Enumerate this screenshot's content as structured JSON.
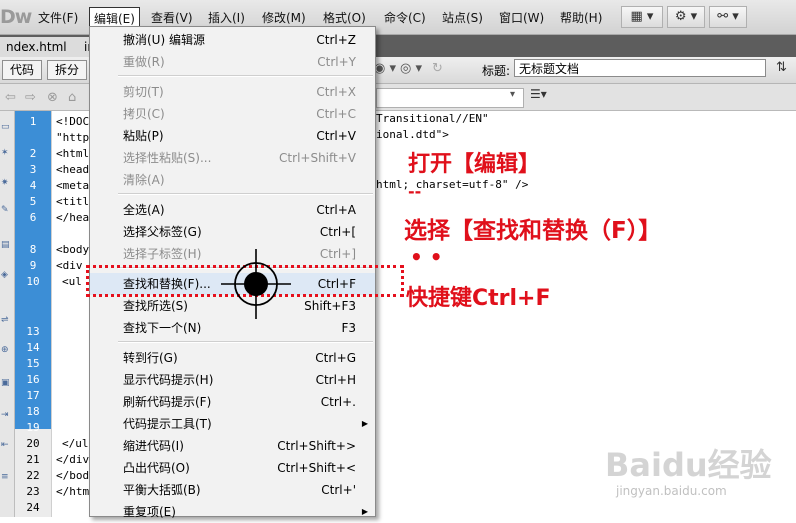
{
  "app": {
    "logo": "Dw"
  },
  "menubar": {
    "items": [
      "文件(F)",
      "编辑(E)",
      "查看(V)",
      "插入(I)",
      "修改(M)",
      "格式(O)",
      "命令(C)",
      "站点(S)",
      "窗口(W)",
      "帮助(H)"
    ],
    "active": "编辑(E)"
  },
  "tabs": [
    {
      "label": "ndex.html",
      "close": "×"
    },
    {
      "label": "ir",
      "close": ""
    }
  ],
  "doc_toolbar": {
    "view_buttons": [
      "代码",
      "拆分"
    ],
    "title_label": "标题:",
    "title_value": "无标题文档"
  },
  "gutter": {
    "line_numbers": [
      "1",
      "",
      "2",
      "3",
      "4",
      "5",
      "6",
      "",
      "8",
      "9",
      "10",
      "",
      "",
      "13",
      "14",
      "15",
      "16",
      "17",
      "18",
      "19",
      "20",
      "21",
      "22",
      "23",
      "24"
    ]
  },
  "code": {
    "left_fragments": [
      "<!DOC",
      "\"http",
      "<html",
      "<head",
      "<meta",
      "<titl",
      "</hea",
      "",
      "<body",
      "<div",
      "<ul",
      "",
      "",
      "",
      "",
      "",
      "",
      "",
      "",
      "",
      "</ul",
      "</div",
      "</bod",
      "</htm",
      ""
    ],
    "right_fragments": [
      "Transitional//EN\"",
      "ional.dtd\">",
      "",
      "",
      "html; charset=utf-8\" />"
    ]
  },
  "edit_menu": {
    "items": [
      {
        "label": "撤消(U) 编辑源",
        "shortcut": "Ctrl+Z",
        "disabled": false
      },
      {
        "label": "重做(R)",
        "shortcut": "Ctrl+Y",
        "disabled": true
      },
      {
        "label": "剪切(T)",
        "shortcut": "Ctrl+X",
        "disabled": true
      },
      {
        "label": "拷贝(C)",
        "shortcut": "Ctrl+C",
        "disabled": true
      },
      {
        "label": "粘贴(P)",
        "shortcut": "Ctrl+V",
        "disabled": false
      },
      {
        "label": "选择性粘贴(S)...",
        "shortcut": "Ctrl+Shift+V",
        "disabled": true
      },
      {
        "label": "清除(A)",
        "shortcut": "",
        "disabled": true
      },
      {
        "label": "全选(A)",
        "shortcut": "Ctrl+A",
        "disabled": false
      },
      {
        "label": "选择父标签(G)",
        "shortcut": "Ctrl+[",
        "disabled": false
      },
      {
        "label": "选择子标签(H)",
        "shortcut": "Ctrl+]",
        "disabled": true
      },
      {
        "label": "查找和替换(F)...",
        "shortcut": "Ctrl+F",
        "disabled": false
      },
      {
        "label": "查找所选(S)",
        "shortcut": "Shift+F3",
        "disabled": false
      },
      {
        "label": "查找下一个(N)",
        "shortcut": "F3",
        "disabled": false
      },
      {
        "label": "转到行(G)",
        "shortcut": "Ctrl+G",
        "disabled": false
      },
      {
        "label": "显示代码提示(H)",
        "shortcut": "Ctrl+H",
        "disabled": false
      },
      {
        "label": "刷新代码提示(F)",
        "shortcut": "Ctrl+.",
        "disabled": false
      },
      {
        "label": "代码提示工具(T)",
        "shortcut": "",
        "disabled": false,
        "submenu": true
      },
      {
        "label": "缩进代码(I)",
        "shortcut": "Ctrl+Shift+>",
        "disabled": false
      },
      {
        "label": "凸出代码(O)",
        "shortcut": "Ctrl+Shift+<",
        "disabled": false
      },
      {
        "label": "平衡大括弧(B)",
        "shortcut": "Ctrl+'",
        "disabled": false
      },
      {
        "label": "重复项(E)",
        "shortcut": "",
        "disabled": false,
        "submenu": true
      }
    ]
  },
  "annotations": {
    "step1": "打开【编辑】",
    "dash": "--",
    "step2": "选择【查找和替换（F）】",
    "dots": "• •",
    "shortcut": "快捷键Ctrl+F"
  },
  "watermark": {
    "brand": "Baidu经验",
    "url": "jingyan.baidu.com"
  },
  "colors": {
    "annotation": "#e0101b",
    "gutter_selection": "#3c8ed6",
    "highlight": "#dde8f5"
  }
}
